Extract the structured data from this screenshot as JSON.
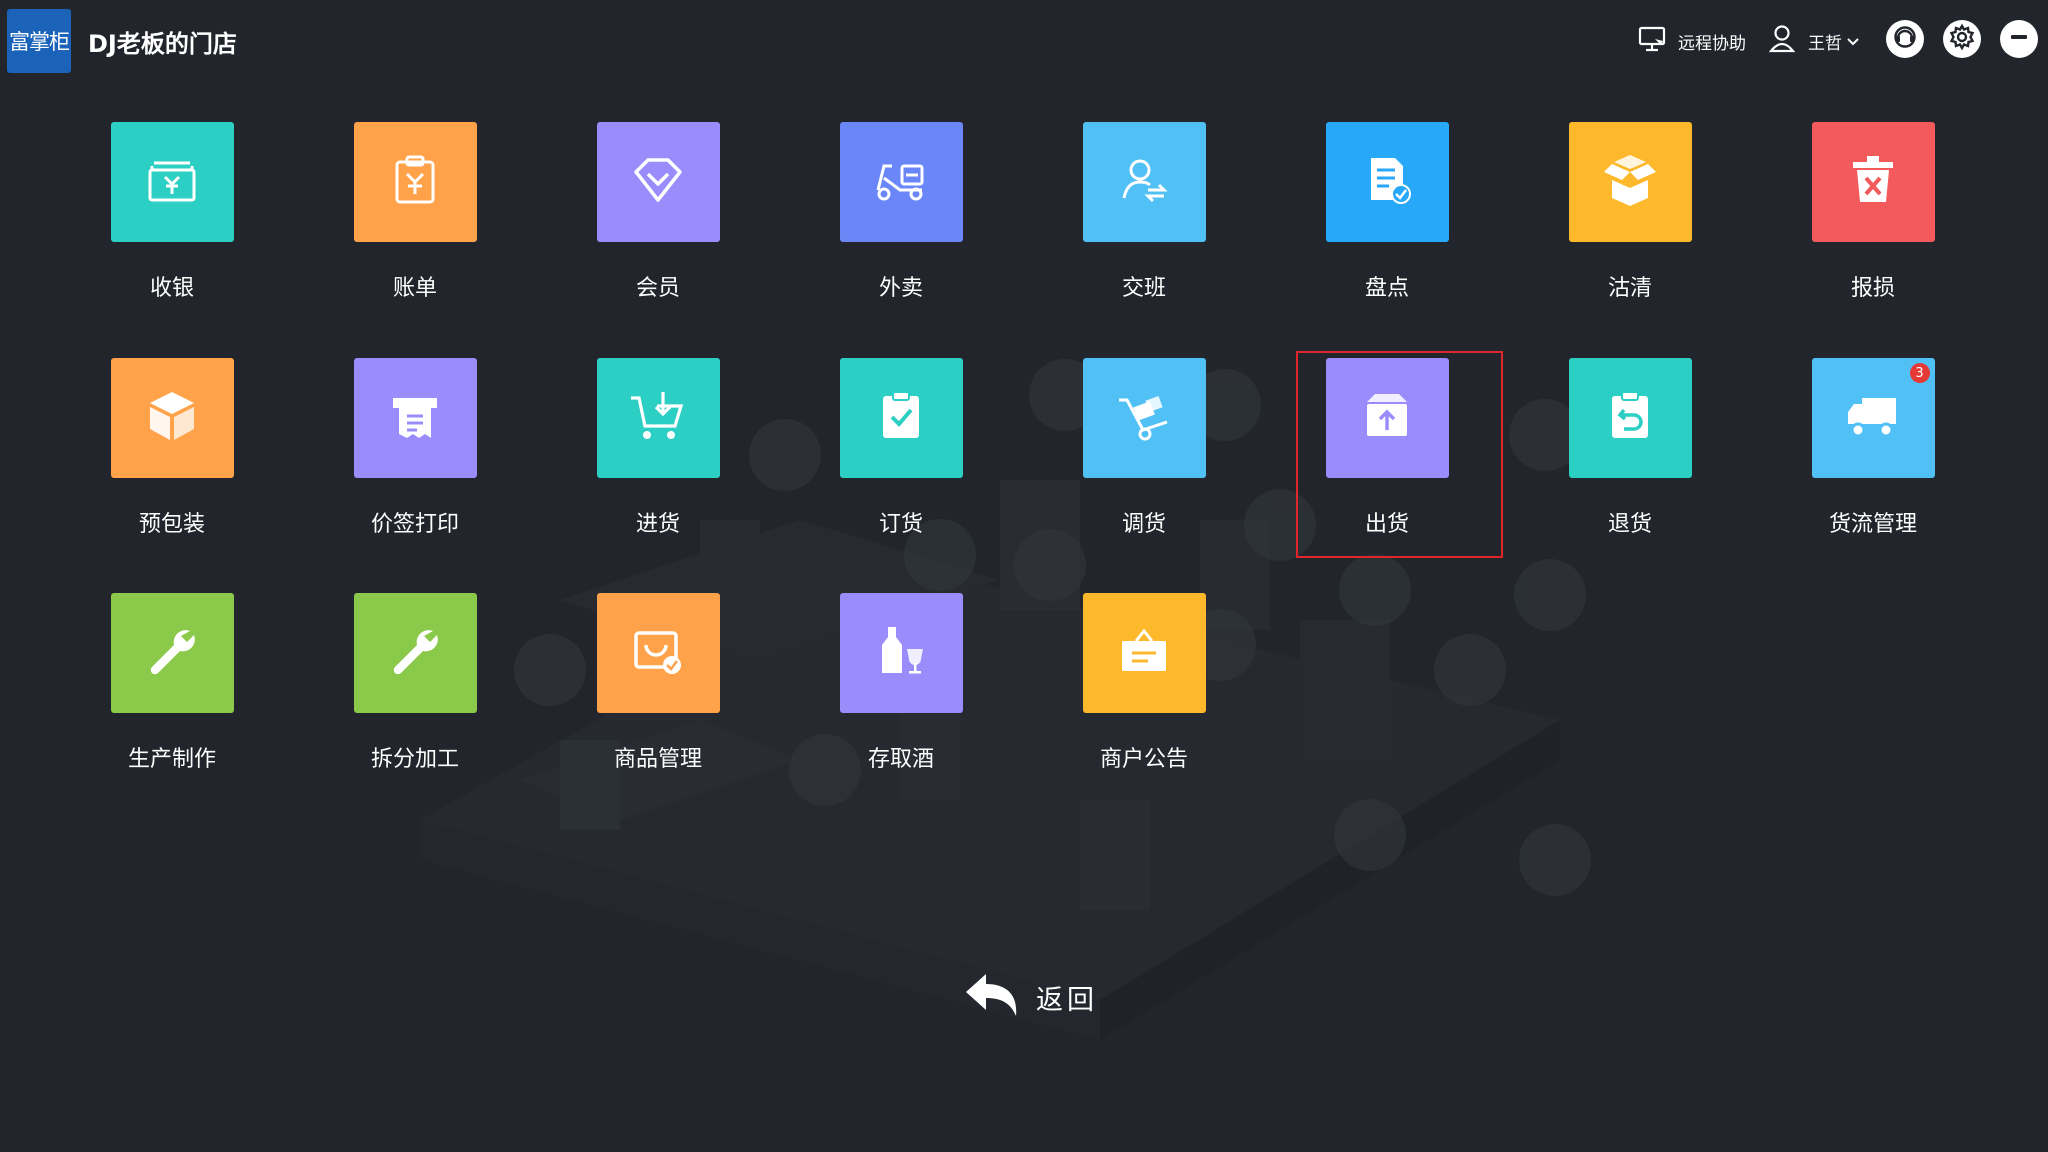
{
  "header": {
    "logo_text": "富掌柜",
    "store_name": "DJ老板的门店",
    "remote_assist_label": "远程协助",
    "user_name": "王哲",
    "icons": [
      "monitor-icon",
      "user-icon",
      "chevron-down-icon",
      "support-icon",
      "gear-icon",
      "minimize-icon"
    ]
  },
  "tiles": [
    {
      "id": "cashier",
      "label": "收银",
      "color": "#2ccfc4",
      "icon": "cash-box-icon"
    },
    {
      "id": "bill",
      "label": "账单",
      "color": "#ffa24a",
      "icon": "clipboard-yen-icon"
    },
    {
      "id": "member",
      "label": "会员",
      "color": "#9b8cfb",
      "icon": "diamond-icon"
    },
    {
      "id": "takeout",
      "label": "外卖",
      "color": "#6a86f7",
      "icon": "scooter-icon"
    },
    {
      "id": "shift",
      "label": "交班",
      "color": "#50c0f5",
      "icon": "user-swap-icon"
    },
    {
      "id": "stocktake",
      "label": "盘点",
      "color": "#27a8f8",
      "icon": "document-check-icon"
    },
    {
      "id": "clear",
      "label": "沽清",
      "color": "#fdb92b",
      "icon": "open-box-icon"
    },
    {
      "id": "damage",
      "label": "报损",
      "color": "#f35a5c",
      "icon": "trash-x-icon"
    },
    {
      "id": "prepack",
      "label": "预包装",
      "color": "#ffa24a",
      "icon": "package-icon"
    },
    {
      "id": "price-label",
      "label": "价签打印",
      "color": "#9b8cfb",
      "icon": "printer-icon"
    },
    {
      "id": "purchase",
      "label": "进货",
      "color": "#2ccfc4",
      "icon": "cart-in-icon"
    },
    {
      "id": "order",
      "label": "订货",
      "color": "#2ccfc4",
      "icon": "clipboard-check-icon"
    },
    {
      "id": "transfer",
      "label": "调货",
      "color": "#50c0f5",
      "icon": "hand-truck-icon"
    },
    {
      "id": "ship",
      "label": "出货",
      "color": "#9b8cfb",
      "icon": "box-upload-icon"
    },
    {
      "id": "return",
      "label": "退货",
      "color": "#2ccfc4",
      "icon": "clipboard-return-icon"
    },
    {
      "id": "logistics",
      "label": "货流管理",
      "color": "#50c0f5",
      "icon": "truck-icon",
      "badge": "3"
    },
    {
      "id": "production",
      "label": "生产制作",
      "color": "#8bc94a",
      "icon": "wrench-icon"
    },
    {
      "id": "processing",
      "label": "拆分加工",
      "color": "#8bc94a",
      "icon": "wrench-icon"
    },
    {
      "id": "products",
      "label": "商品管理",
      "color": "#ffa24a",
      "icon": "product-manage-icon"
    },
    {
      "id": "wine",
      "label": "存取酒",
      "color": "#9b8cfb",
      "icon": "wine-bottle-icon"
    },
    {
      "id": "notice",
      "label": "商户公告",
      "color": "#fdb92b",
      "icon": "notice-board-icon"
    }
  ],
  "selected_tile": "ship",
  "back_label": "返回"
}
